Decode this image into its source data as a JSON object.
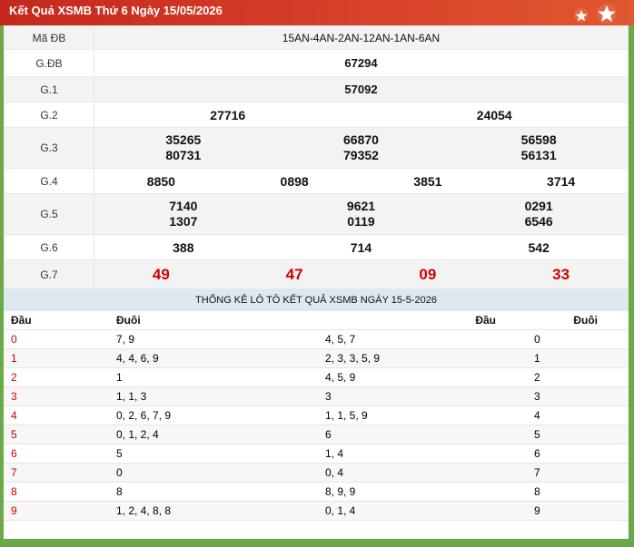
{
  "header": {
    "title": "Kết Quả XSMB Thứ 6 Ngày 15/05/2026"
  },
  "results": {
    "ma_db_label": "Mã ĐB",
    "ma_db_value": "15AN-4AN-2AN-12AN-1AN-6AN",
    "rows": [
      {
        "label": "G.ĐB",
        "values": [
          "67294"
        ]
      },
      {
        "label": "G.1",
        "values": [
          "57092"
        ]
      },
      {
        "label": "G.2",
        "values": [
          "27716",
          "24054"
        ]
      },
      {
        "label": "G.3",
        "values": [
          "35265",
          "80731",
          "66870",
          "79352",
          "56598",
          "56131"
        ]
      },
      {
        "label": "G.4",
        "values": [
          "8850",
          "0898",
          "3851",
          "3714"
        ]
      },
      {
        "label": "G.5",
        "values": [
          "7140",
          "1307",
          "9621",
          "0119",
          "0291",
          "6546"
        ]
      },
      {
        "label": "G.6",
        "values": [
          "388",
          "714",
          "542"
        ]
      },
      {
        "label": "G.7",
        "values": [
          "49",
          "47",
          "09",
          "33"
        ]
      }
    ]
  },
  "stats": {
    "title": "THỐNG KÊ LÔ TÔ KẾT QUẢ XSMB NGÀY 15-5-2026",
    "headers": [
      "Đầu",
      "Đuôi",
      "Đầu",
      "Đuôi"
    ],
    "rows": [
      [
        "0",
        "7, 9",
        "4, 5, 7",
        "0"
      ],
      [
        "1",
        "4, 4, 6, 9",
        "2, 3, 3, 5, 9",
        "1"
      ],
      [
        "2",
        "1",
        "4, 5, 9",
        "2"
      ],
      [
        "3",
        "1, 1, 3",
        "3",
        "3"
      ],
      [
        "4",
        "0, 2, 6, 7, 9",
        "1, 1, 5, 9",
        "4"
      ],
      [
        "5",
        "0, 1, 2, 4",
        "6",
        "5"
      ],
      [
        "6",
        "5",
        "1, 4",
        "6"
      ],
      [
        "7",
        "0",
        "0, 4",
        "7"
      ],
      [
        "8",
        "8",
        "8, 9, 9",
        "8"
      ],
      [
        "9",
        "1, 2, 4, 8, 8",
        "0, 1, 4",
        "9"
      ]
    ]
  },
  "colors": {
    "header": "#c4281e",
    "accent_red": "#d00000",
    "frame": "#6aaa48"
  }
}
